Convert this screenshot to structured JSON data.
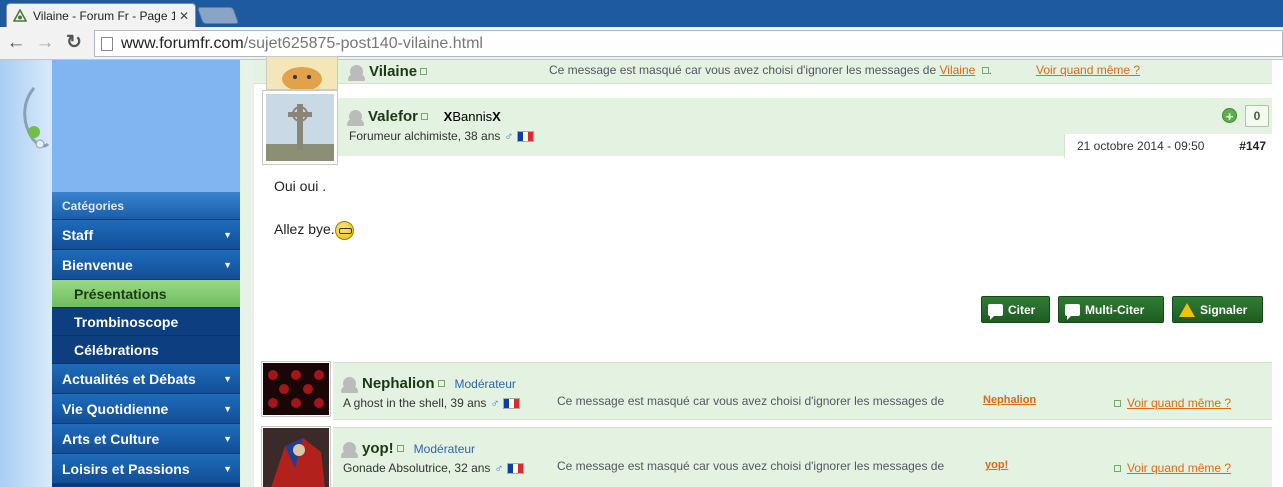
{
  "browser": {
    "tab_title": "Vilaine - Forum Fr - Page 1",
    "tab_close": "✕",
    "url_host": "www.forumfr.com",
    "url_path": "/sujet625875-post140-vilaine.html",
    "back": "←",
    "forward": "→",
    "reload": "↻"
  },
  "sidebar": {
    "header": "Catégories",
    "caret": "▼",
    "items": [
      {
        "label": "Staff"
      },
      {
        "label": "Bienvenue"
      }
    ],
    "subitems": [
      {
        "label": "Présentations"
      },
      {
        "label": "Trombinoscope"
      },
      {
        "label": "Célébrations"
      }
    ],
    "items_bottom": [
      {
        "label": "Actualités et Débats"
      },
      {
        "label": "Vie Quotidienne"
      },
      {
        "label": "Arts et Culture"
      },
      {
        "label": "Loisirs et Passions"
      }
    ]
  },
  "posts": {
    "vilaine": {
      "username": "Vilaine",
      "hidden_prefix": "Ce message est masqué car vous avez choisi d'ignorer les messages de ",
      "see_anyway": "Voir quand même ?"
    },
    "valefor": {
      "username": "Valefor",
      "status_x1": "X",
      "status_middle": "Bannis",
      "status_x2": "X",
      "rank": "Forumeur alchimiste, 38 ans",
      "male": "♂",
      "date": "21 octobre 2014 - 09:50",
      "number": "#147",
      "plus": "+",
      "reputation": "0",
      "body_line1": "Oui oui .",
      "body_line2": "Allez bye.",
      "buttons": {
        "quote": "Citer",
        "multi_quote": "Multi-Citer",
        "report": "Signaler"
      }
    },
    "nephalion": {
      "username": "Nephalion",
      "role": "Modérateur",
      "rank": "A ghost in the shell, 39 ans",
      "male": "♂",
      "hidden_prefix": "Ce message est masqué car vous avez choisi d'ignorer les messages de",
      "see_anyway": "Voir quand même ?"
    },
    "yop": {
      "username": "yop!",
      "role": "Modérateur",
      "rank": "Gonade Absolutrice, 32 ans",
      "male": "♂",
      "hidden_prefix": "Ce message est masqué car vous avez choisi d'ignorer les messages de",
      "see_anyway": "Voir quand même ?"
    }
  },
  "colors": {
    "accent_orange": "#e06a10",
    "post_green": "#e4f2e1",
    "sidebar_blue": "#124f96",
    "button_green": "#2e7d33"
  }
}
